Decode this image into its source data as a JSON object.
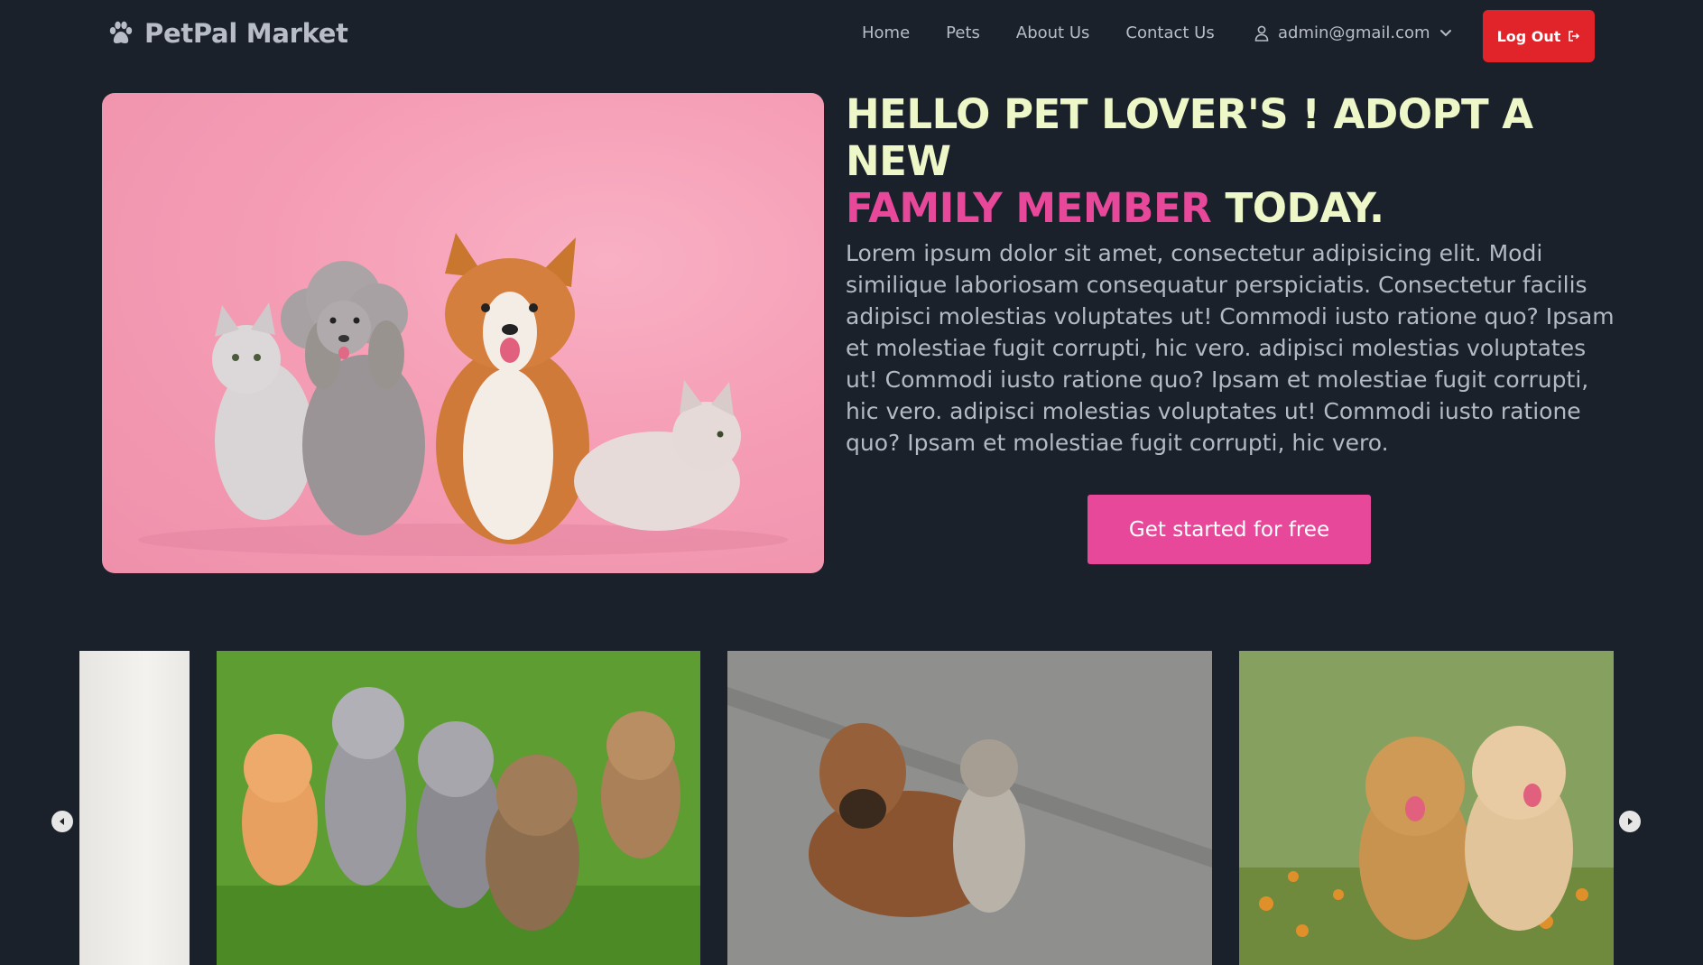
{
  "brand": {
    "name": "PetPal Market"
  },
  "nav": {
    "links": [
      "Home",
      "Pets",
      "About Us",
      "Contact Us"
    ],
    "user_email": "admin@gmail.com",
    "logout_label": "Log Out"
  },
  "hero": {
    "title_line1": "HELLO PET LOVER'S ! ADOPT A NEW",
    "title_highlight": "FAMILY MEMBER",
    "title_end": "TODAY.",
    "body": "Lorem ipsum dolor sit amet, consectetur adipisicing elit. Modi similique laboriosam consequatur perspiciatis. Consectetur facilis adipisci molestias voluptates ut! Commodi iusto ratione quo? Ipsam et molestiae fugit corrupti, hic vero. adipisci molestias voluptates ut! Commodi iusto ratione quo? Ipsam et molestiae fugit corrupti, hic vero. adipisci molestias voluptates ut! Commodi iusto ratione quo? Ipsam et molestiae fugit corrupti, hic vero.",
    "cta_label": "Get started for free"
  },
  "colors": {
    "background": "#1b212b",
    "accent_pink": "#e8489a",
    "title_cream": "#eef7c8",
    "logout_red": "#e0242a"
  },
  "icons": [
    "paw-icon",
    "user-icon",
    "chevron-down-icon",
    "logout-icon",
    "arrow-left-icon",
    "arrow-right-icon"
  ]
}
